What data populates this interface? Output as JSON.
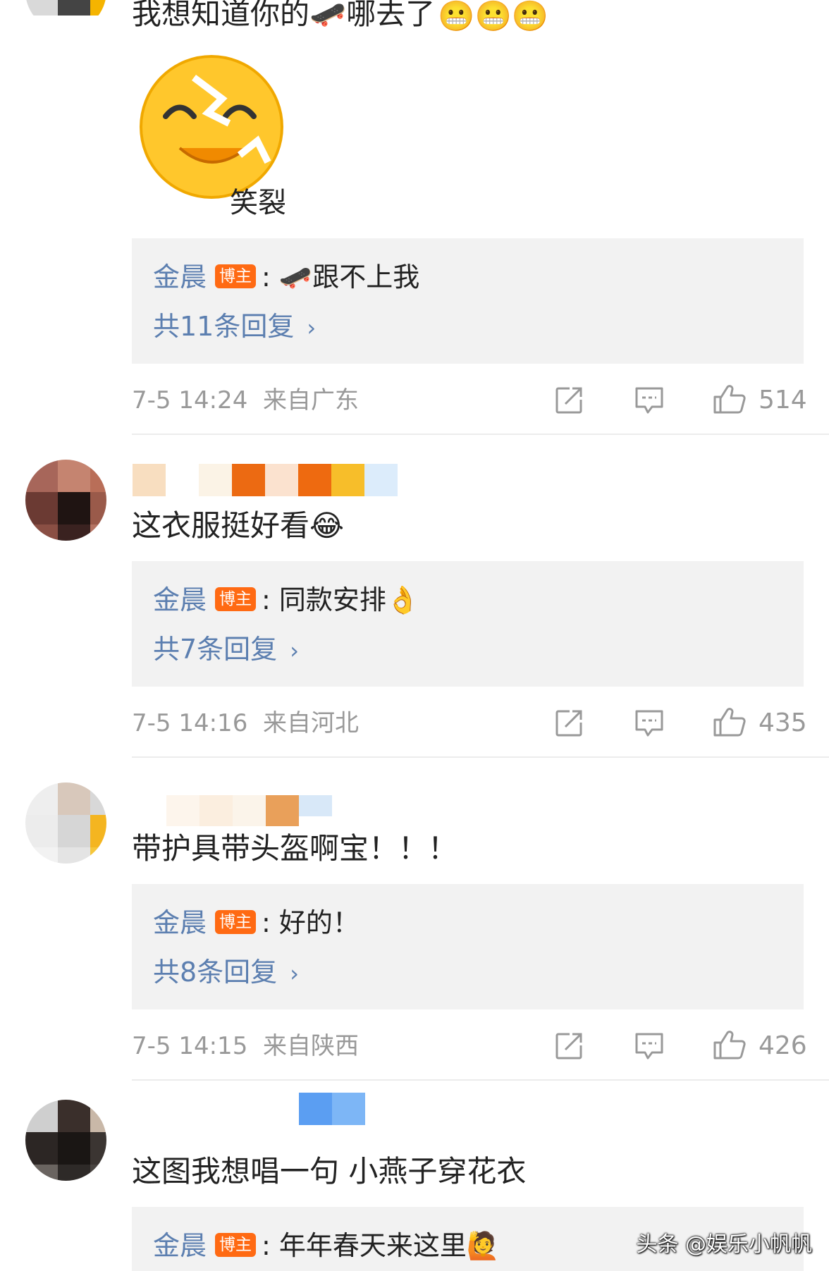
{
  "comments": [
    {
      "text": "我想知道你的🛹哪去了",
      "sticker_caption": "笑裂",
      "reply": {
        "author": "金晨",
        "badge": "博主",
        "text": "🛹跟不上我",
        "count_label": "共11条回复"
      },
      "time": "7-5 14:24",
      "location": "来自广东",
      "likes": "514"
    },
    {
      "text": "这衣服挺好看😂",
      "reply": {
        "author": "金晨",
        "badge": "博主",
        "text": "同款安排👌",
        "count_label": "共7条回复"
      },
      "time": "7-5 14:16",
      "location": "来自河北",
      "likes": "435"
    },
    {
      "text": "带护具带头盔啊宝！！！",
      "reply": {
        "author": "金晨",
        "badge": "博主",
        "text": "好的！",
        "count_label": "共8条回复"
      },
      "time": "7-5 14:15",
      "location": "来自陕西",
      "likes": "426"
    },
    {
      "text": "这图我想唱一句 小燕子穿花衣",
      "reply": {
        "author": "金晨",
        "badge": "博主",
        "text": "年年春天来这里🙋"
      }
    }
  ],
  "watermark": "头条 @娱乐小帆帆",
  "icons": {
    "repost": "repost-icon",
    "comment": "comment-icon",
    "like": "thumbs-up-icon",
    "chevron": "chevron-right-icon"
  },
  "colors": {
    "link_blue": "#5c7fb0",
    "badge_orange": "#ff6a13",
    "reply_bg": "#f2f2f2",
    "meta_gray": "#999999"
  }
}
